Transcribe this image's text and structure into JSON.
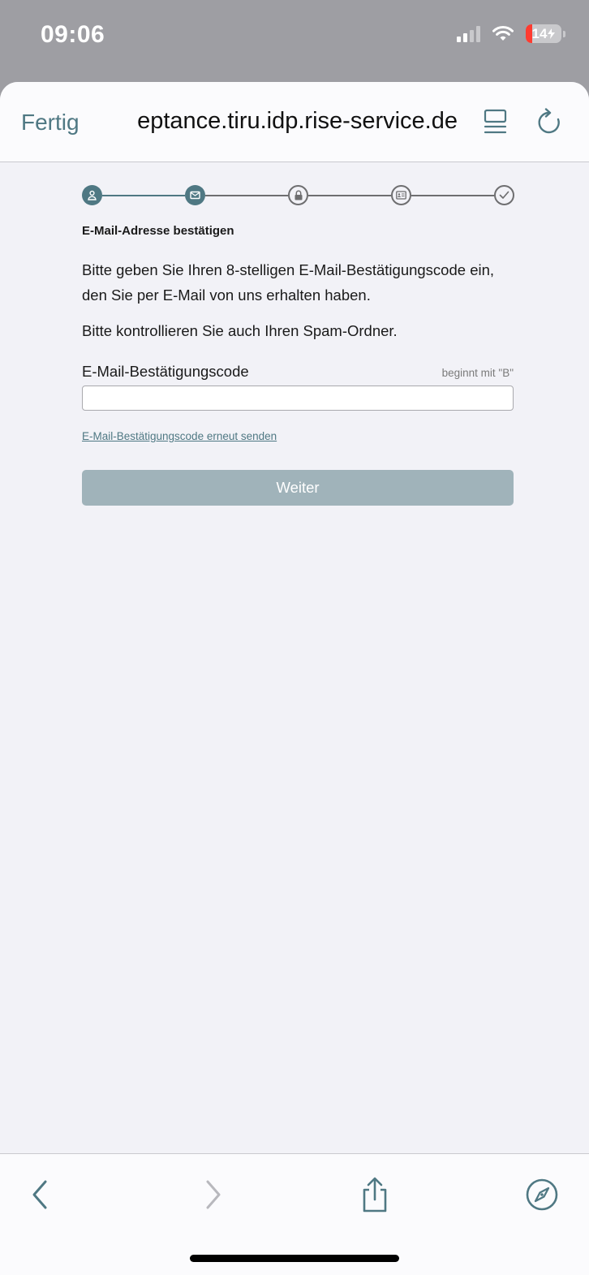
{
  "status_bar": {
    "time": "09:06",
    "battery_level": "14",
    "icons": [
      "signal-icon",
      "wifi-icon",
      "battery-charging-icon"
    ]
  },
  "browser": {
    "done_label": "Fertig",
    "url": "eptance.tiru.idp.rise-service.de",
    "icons": [
      "reader-mode-icon",
      "reload-icon"
    ]
  },
  "stepper": {
    "steps": [
      {
        "icon": "user-icon",
        "state": "done"
      },
      {
        "icon": "envelope-icon",
        "state": "done"
      },
      {
        "icon": "lock-icon",
        "state": "todo"
      },
      {
        "icon": "id-card-icon",
        "state": "todo"
      },
      {
        "icon": "checkmark-icon",
        "state": "todo"
      }
    ]
  },
  "form": {
    "heading": "E-Mail-Adresse bestätigen",
    "instructions": "Bitte geben Sie Ihren 8-stelligen E-Mail-Bestätigungscode ein, den Sie per E-Mail von uns erhalten haben.",
    "spam_note": "Bitte kontrollieren Sie auch Ihren Spam-Ordner.",
    "code_label": "E-Mail-Bestätigungscode",
    "code_hint": "beginnt mit \"B\"",
    "code_value": "",
    "resend_link": "E-Mail-Bestätigungscode erneut senden",
    "submit_label": "Weiter"
  },
  "toolbar": {
    "icons": [
      "back-icon",
      "forward-icon",
      "share-icon",
      "compass-icon"
    ]
  },
  "colors": {
    "accent": "#4f7883",
    "button_disabled": "#a0b3ba",
    "background": "#f2f2f7",
    "status_bar": "#9e9ea3"
  }
}
